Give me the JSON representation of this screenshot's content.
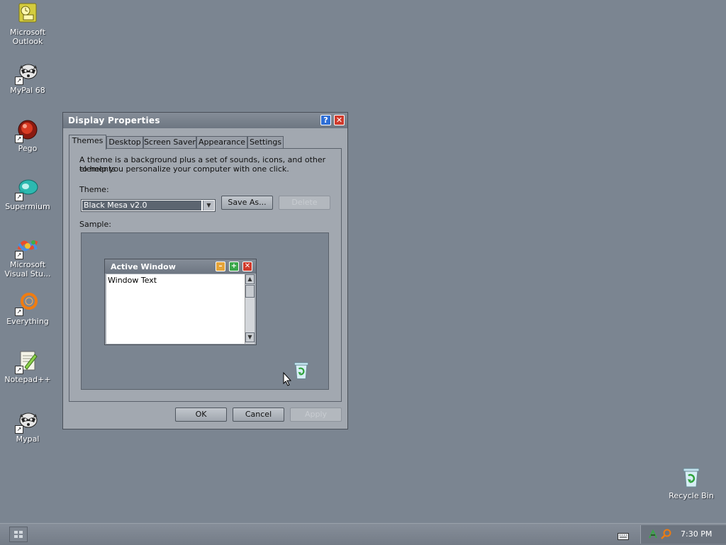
{
  "desktop": {
    "icons": [
      {
        "label": "Microsoft\nOutlook",
        "l1": "Microsoft",
        "l2": "Outlook"
      },
      {
        "label": "MyPal 68"
      },
      {
        "label": "Pego"
      },
      {
        "label": "Supermium"
      },
      {
        "l1": "Microsoft",
        "l2": "Visual Stu..."
      },
      {
        "label": "Everything"
      },
      {
        "label": "Notepad++"
      },
      {
        "label": "Mypal"
      },
      {
        "label": "Recycle Bin"
      }
    ]
  },
  "window": {
    "title": "Display Properties",
    "tabs": [
      "Themes",
      "Desktop",
      "Screen Saver",
      "Appearance",
      "Settings"
    ],
    "description_line1": "A theme is a background plus a set of sounds, icons, and other elements",
    "description_line2": "to help you personalize your computer with one click.",
    "theme_label": "Theme:",
    "theme_value": "Black Mesa v2.0",
    "save_as_label": "Save As...",
    "delete_label": "Delete",
    "sample_label": "Sample:",
    "sample": {
      "active_window_title": "Active Window",
      "window_text": "Window Text"
    },
    "ok_label": "OK",
    "cancel_label": "Cancel",
    "apply_label": "Apply"
  },
  "taskbar": {
    "clock": "7:30 PM"
  },
  "colors": {
    "desktop_bg": "#7b8591",
    "window_bg": "#a2a8b0",
    "titlebar": "#7b8490",
    "help_button": "#2f6fd6",
    "close_button": "#d03a2c",
    "minimize_button": "#e6a53a",
    "maximize_button": "#3aa74a"
  }
}
